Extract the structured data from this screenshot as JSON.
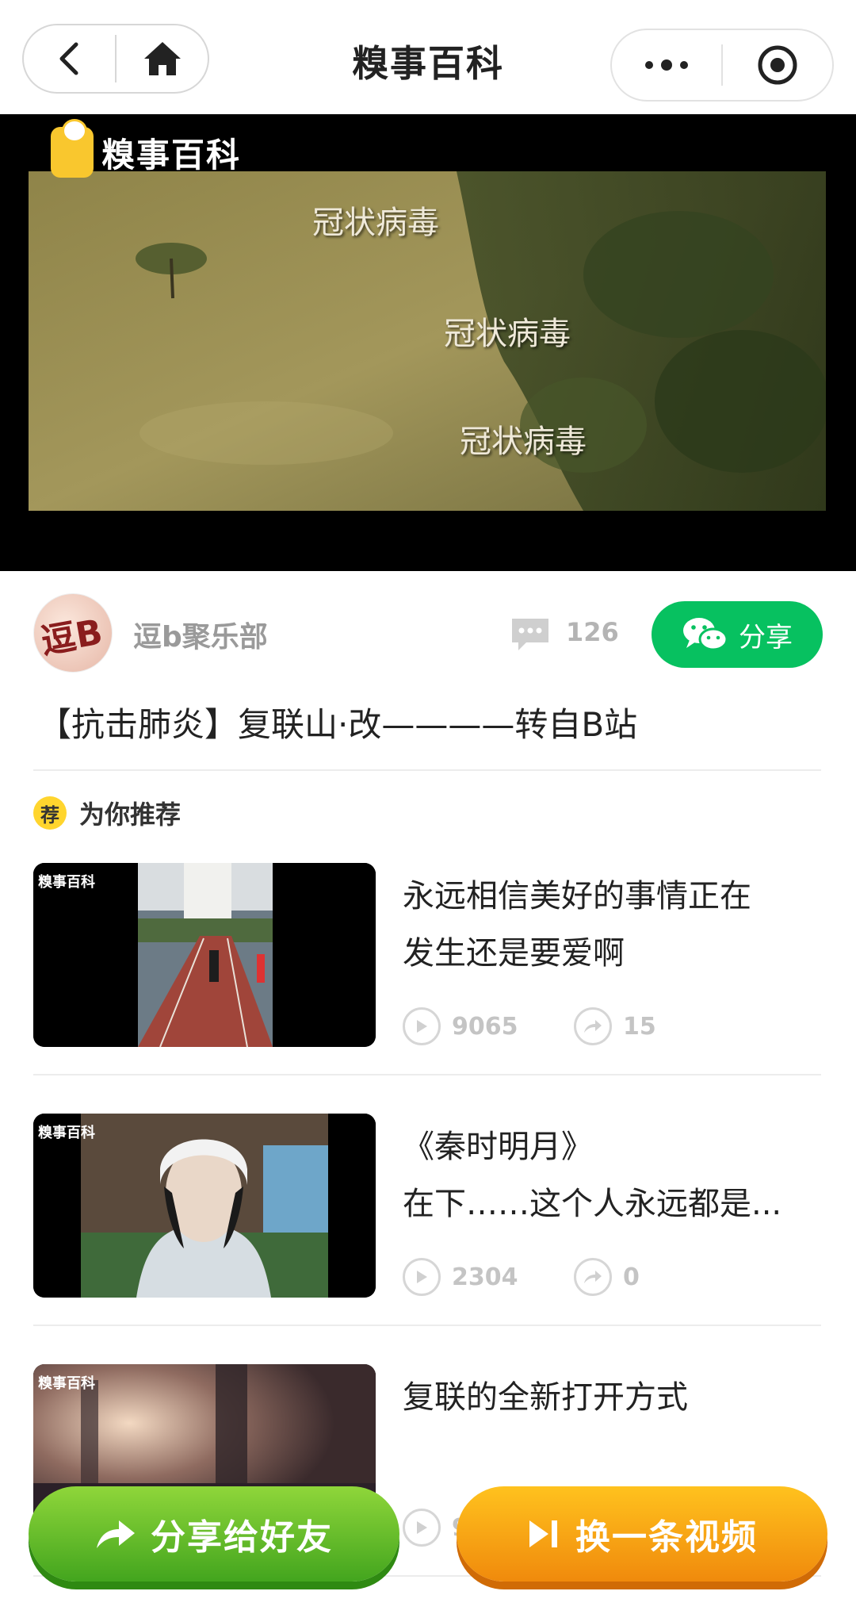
{
  "nav": {
    "title": "糗事百科",
    "back_icon": "back-arrow-icon",
    "home_icon": "home-icon",
    "more_icon": "more-dots-icon",
    "close_icon": "mini-program-target-icon"
  },
  "video": {
    "logo_text": "糗事百科",
    "subtitles": [
      "冠状病毒",
      "冠状病毒",
      "冠状病毒"
    ]
  },
  "author": {
    "avatar_text": "逗B",
    "name": "逗b聚乐部",
    "comment_count": "126",
    "share_label": "分享",
    "brand_color": "#07c160"
  },
  "main": {
    "video_title": "【抗击肺炎】复联山·改————转自B站"
  },
  "recommend": {
    "badge": "荐",
    "label": "为你推荐",
    "items": [
      {
        "thumb_logo": "糗事百科",
        "title_lines": [
          "永远相信美好的事情正在",
          "发生还是要爱啊"
        ],
        "plays": "9065",
        "shares": "15"
      },
      {
        "thumb_logo": "糗事百科",
        "title_lines": [
          "《秦时明月》",
          "在下……这个人永远都是..."
        ],
        "plays": "2304",
        "shares": "0"
      },
      {
        "thumb_logo": "糗事百科",
        "title_lines": [
          "复联的全新打开方式"
        ],
        "plays": "9",
        "shares": ""
      }
    ]
  },
  "bottom": {
    "share_friend_label": "分享给好友",
    "next_video_label": "换一条视频",
    "share_color": "#43a51e",
    "next_color": "#f08a0c"
  }
}
